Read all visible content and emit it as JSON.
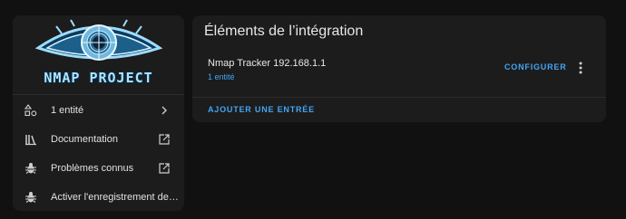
{
  "logo": {
    "text": "NMAP PROJECT",
    "icon": "nmap-eye-logo"
  },
  "sidebar": {
    "items": [
      {
        "label": "1 entité",
        "icon": "devices-icon",
        "trail_icon": "chevron-right-icon"
      },
      {
        "label": "Documentation",
        "icon": "book-icon",
        "trail_icon": "open-in-new-icon"
      },
      {
        "label": "Problèmes connus",
        "icon": "bug-icon",
        "trail_icon": "open-in-new-icon"
      },
      {
        "label": "Activer l'enregistrement des journaux de débogage",
        "icon": "bug-icon"
      }
    ]
  },
  "integration": {
    "title": "Éléments de l’intégration",
    "entry": {
      "name": "Nmap Tracker 192.168.1.1",
      "sub": "1 entité",
      "configure_label": "CONFIGURER"
    },
    "add_entry_label": "AJOUTER UNE ENTRÉE"
  },
  "colors": {
    "background": "#111111",
    "card": "#1c1c1c",
    "accent": "#42a5f5",
    "text": "#e1e1e1"
  }
}
